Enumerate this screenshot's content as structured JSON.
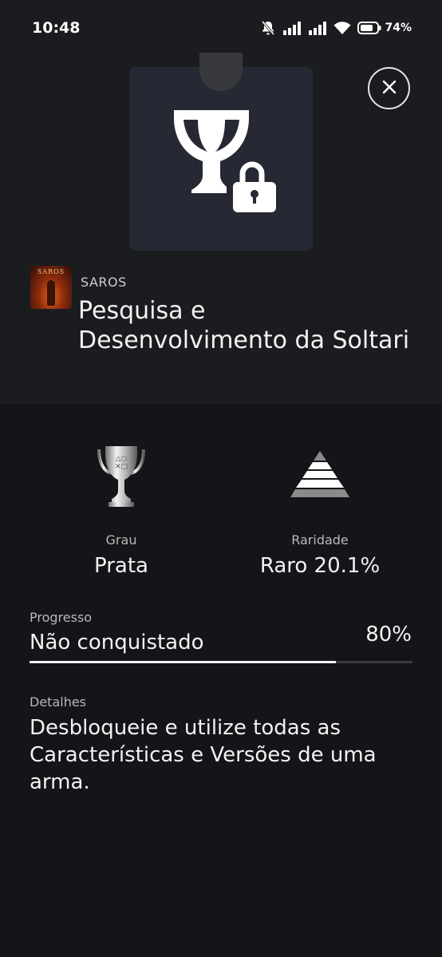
{
  "status_bar": {
    "time": "10:48",
    "battery": "74%",
    "icons": [
      "mute-icon",
      "signal-icon",
      "signal-icon",
      "wifi-icon",
      "battery-icon"
    ]
  },
  "trophy": {
    "state_icon": "locked-trophy-icon",
    "game_name": "SAROS",
    "game_thumbnail_text": "SAROS",
    "title": "Pesquisa e Desenvolvimento da Soltari"
  },
  "stats": {
    "grade_label": "Grau",
    "grade_value": "Prata",
    "grade_icon": "silver-trophy-icon",
    "rarity_label": "Raridade",
    "rarity_value": "Raro 20.1%",
    "rarity_icon": "rarity-pyramid-icon"
  },
  "progress": {
    "label": "Progresso",
    "status": "Não conquistado",
    "percent_text": "80%",
    "fraction": 0.8
  },
  "details": {
    "label": "Detalhes",
    "text": "Desbloqueie e utilize todas as Características e Versões de uma arma."
  },
  "colors": {
    "background": "#141518",
    "header_background": "#1b1c1f",
    "card_background": "#262933"
  }
}
